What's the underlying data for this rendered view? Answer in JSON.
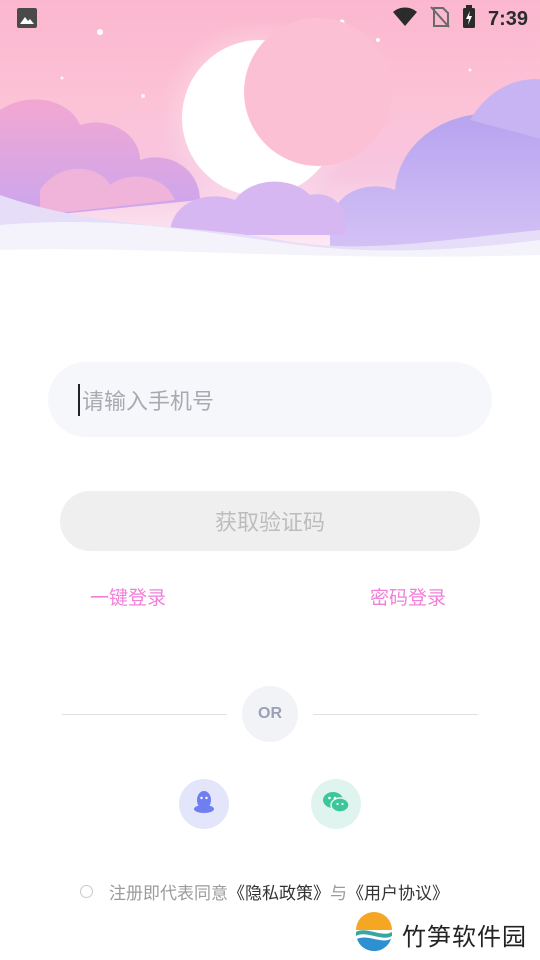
{
  "status_bar": {
    "time": "7:39",
    "icons": [
      "image-icon",
      "wifi-icon",
      "no-sim-icon",
      "battery-charging-icon"
    ]
  },
  "login": {
    "phone_placeholder": "请输入手机号",
    "get_code_label": "获取验证码",
    "one_click_login_label": "一键登录",
    "password_login_label": "密码登录"
  },
  "divider": {
    "or_label": "OR"
  },
  "social": {
    "items": [
      {
        "name": "qq",
        "icon": "qq-icon",
        "color": "#6f7ff1"
      },
      {
        "name": "wechat",
        "icon": "wechat-icon",
        "color": "#3cc79a"
      }
    ]
  },
  "agreement": {
    "prefix": "注册即代表同意",
    "privacy_label": "《隐私政策》",
    "connector": "与",
    "terms_label": "《用户协议》"
  },
  "watermark": {
    "text": "竹笋软件园"
  },
  "colors": {
    "accent_pink": "#f27fd9",
    "input_bg": "#f6f7fb",
    "button_bg": "#efefef"
  }
}
